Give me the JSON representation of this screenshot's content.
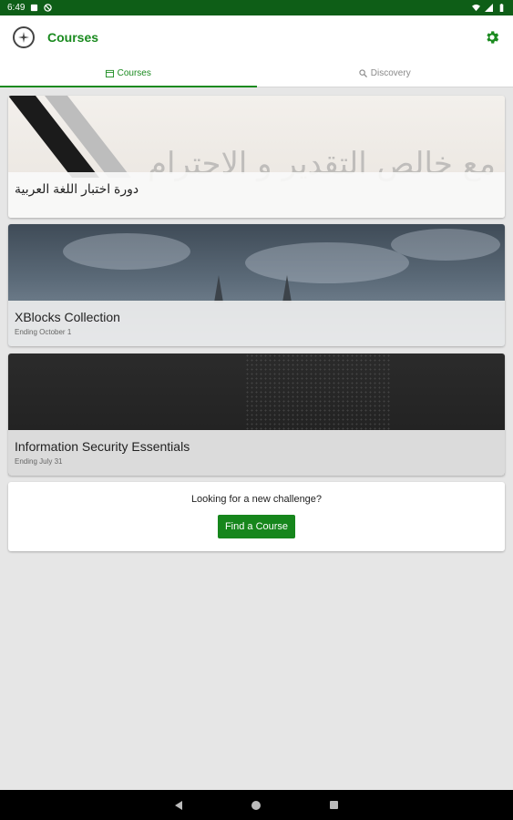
{
  "status_bar": {
    "time": "6:49"
  },
  "app_bar": {
    "title": "Courses",
    "logo_icon": "university-seal-icon",
    "settings_icon": "gear-icon"
  },
  "tabs": [
    {
      "label": "Courses",
      "icon": "calendar-icon",
      "active": true
    },
    {
      "label": "Discovery",
      "icon": "search-icon",
      "active": false
    }
  ],
  "courses": [
    {
      "title": "دورة اختبار اللغة العربية",
      "subtitle": "",
      "watermark": "مع خالص التقدير و الاحترام"
    },
    {
      "title": "XBlocks Collection",
      "subtitle": "Ending October 1"
    },
    {
      "title": "Information Security Essentials",
      "subtitle": "Ending July 31"
    }
  ],
  "find_course": {
    "prompt": "Looking for a new challenge?",
    "button_label": "Find a Course"
  },
  "colors": {
    "status_bar": "#0e5e17",
    "accent": "#1a8a1f",
    "button": "#16861c",
    "background": "#e6e6e6"
  }
}
